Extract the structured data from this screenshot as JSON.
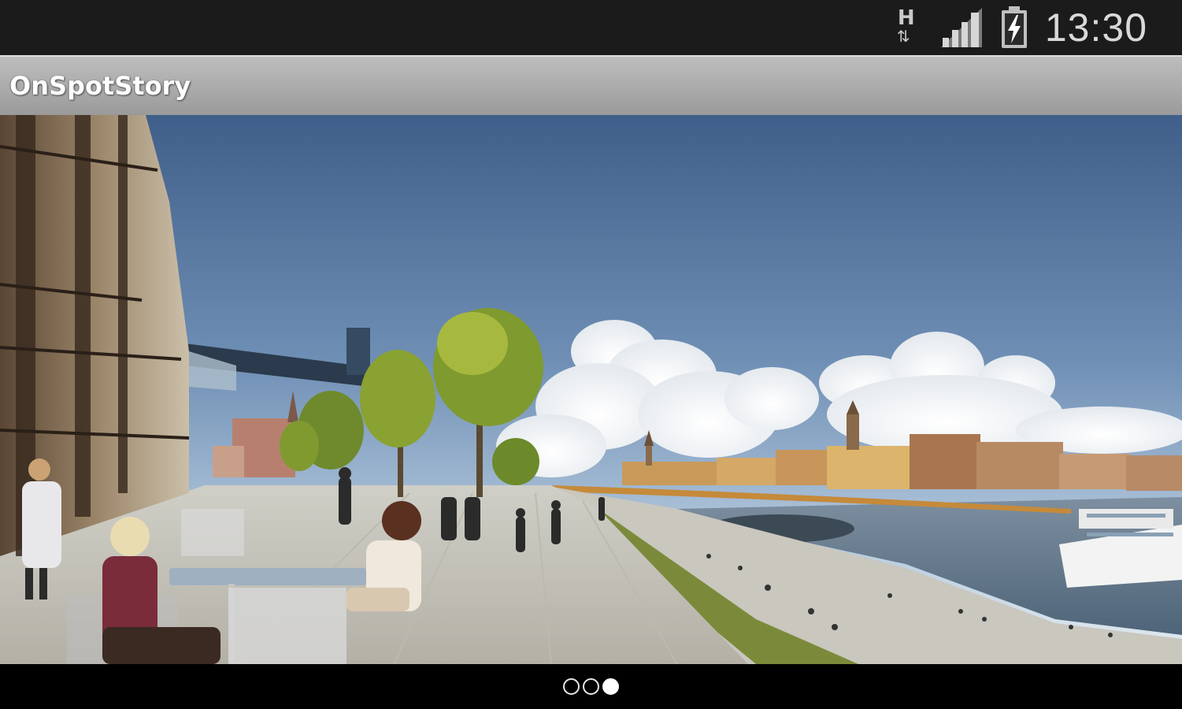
{
  "status_bar": {
    "network_type": "H",
    "network_arrows": "⇅",
    "signal_icon": "signal-strength-icon",
    "battery_icon": "battery-charging-icon",
    "time": "13:30"
  },
  "action_bar": {
    "title": "OnSpotStory"
  },
  "hero": {
    "description_icon": "waterfront-city-rendering-image"
  },
  "pager": {
    "page_count": 3,
    "active_page": 3
  }
}
